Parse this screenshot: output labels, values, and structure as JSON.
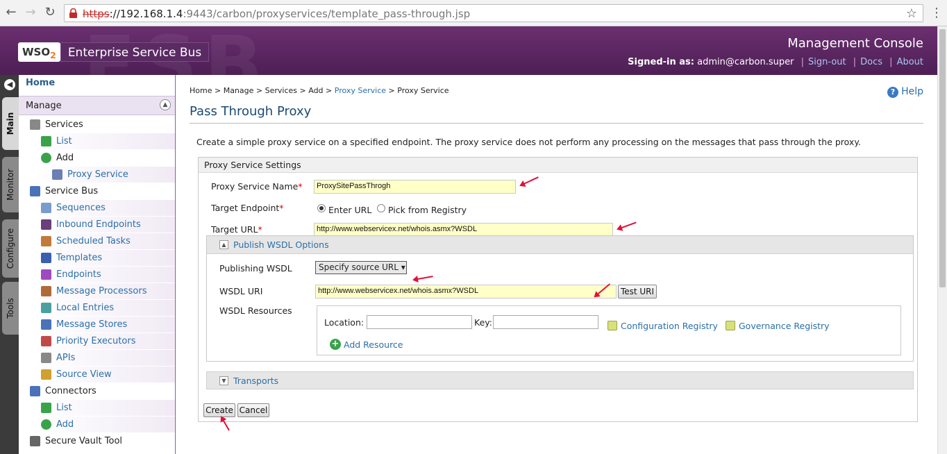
{
  "browser": {
    "url_scheme": "https",
    "url_host": "://192.168.1.4",
    "url_rest": ":9443/carbon/proxyservices/template_pass-through.jsp"
  },
  "header": {
    "logo_wso": "WSO",
    "logo_2": "2",
    "logo_product": "Enterprise Service Bus",
    "console_title": "Management Console",
    "signed_in_label": "Signed-in as:",
    "signed_in_user": "admin@carbon.super",
    "sign_out": "Sign-out",
    "docs": "Docs",
    "about": "About"
  },
  "vtabs": {
    "main": "Main",
    "monitor": "Monitor",
    "configure": "Configure",
    "tools": "Tools"
  },
  "sidebar": {
    "home": "Home",
    "manage": "Manage",
    "items": [
      {
        "label": "Services",
        "kind": "cat",
        "icon": "gear-icon"
      },
      {
        "label": "List",
        "kind": "sub",
        "icon": "list-icon"
      },
      {
        "label": "Add",
        "kind": "cat2",
        "icon": "add-icon"
      },
      {
        "label": "Proxy Service",
        "kind": "sub2",
        "icon": "proxy-icon"
      },
      {
        "label": "Service Bus",
        "kind": "cat",
        "icon": "service-bus-icon"
      },
      {
        "label": "Sequences",
        "kind": "sub",
        "icon": "sequences-icon"
      },
      {
        "label": "Inbound Endpoints",
        "kind": "sub",
        "icon": "inbound-icon"
      },
      {
        "label": "Scheduled Tasks",
        "kind": "sub",
        "icon": "tasks-icon"
      },
      {
        "label": "Templates",
        "kind": "sub",
        "icon": "templates-icon"
      },
      {
        "label": "Endpoints",
        "kind": "sub",
        "icon": "endpoints-icon"
      },
      {
        "label": "Message Processors",
        "kind": "sub",
        "icon": "processors-icon"
      },
      {
        "label": "Local Entries",
        "kind": "sub",
        "icon": "local-entries-icon"
      },
      {
        "label": "Message Stores",
        "kind": "sub",
        "icon": "stores-icon"
      },
      {
        "label": "Priority Executors",
        "kind": "sub",
        "icon": "executors-icon"
      },
      {
        "label": "APIs",
        "kind": "sub",
        "icon": "apis-icon"
      },
      {
        "label": "Source View",
        "kind": "sub",
        "icon": "source-view-icon"
      },
      {
        "label": "Connectors",
        "kind": "cat",
        "icon": "connectors-icon"
      },
      {
        "label": "List",
        "kind": "sub",
        "icon": "list-icon"
      },
      {
        "label": "Add",
        "kind": "sub",
        "icon": "add-icon"
      },
      {
        "label": "Secure Vault Tool",
        "kind": "cat",
        "icon": "vault-icon"
      }
    ]
  },
  "breadcrumb": {
    "home": "Home",
    "manage": "Manage",
    "services": "Services",
    "add": "Add",
    "proxy_service_link": "Proxy Service",
    "current": "Proxy Service",
    "sep": ">"
  },
  "help": "Help",
  "page": {
    "title": "Pass Through Proxy",
    "description": "Create a simple proxy service on a specified endpoint. The proxy service does not perform any processing on the messages that pass through the proxy."
  },
  "form": {
    "section_title": "Proxy Service Settings",
    "name_label": "Proxy Service Name",
    "name_value": "ProxySitePassThrogh",
    "required_mark": "*",
    "target_endpoint_label": "Target Endpoint",
    "enter_url": "Enter URL",
    "pick_registry": "Pick from Registry",
    "target_url_label": "Target URL",
    "target_url_value": "http://www.webservicex.net/whois.asmx?WSDL",
    "wsdl_section": "Publish WSDL Options",
    "publishing_wsdl_label": "Publishing WSDL",
    "publishing_wsdl_value": "Specify source URL",
    "wsdl_uri_label": "WSDL URI",
    "wsdl_uri_value": "http://www.webservicex.net/whois.asmx?WSDL",
    "test_uri": "Test URI",
    "wsdl_resources_label": "WSDL Resources",
    "location_label": "Location:",
    "key_label": "Key:",
    "config_registry": "Configuration Registry",
    "gov_registry": "Governance Registry",
    "add_resource": "Add Resource",
    "transports": "Transports",
    "create": "Create",
    "cancel": "Cancel"
  },
  "colors": {
    "header": "#5a2a63",
    "link": "#2a6fa8",
    "input_highlight": "#ffffc8",
    "annotation_arrow": "#e0103a"
  }
}
